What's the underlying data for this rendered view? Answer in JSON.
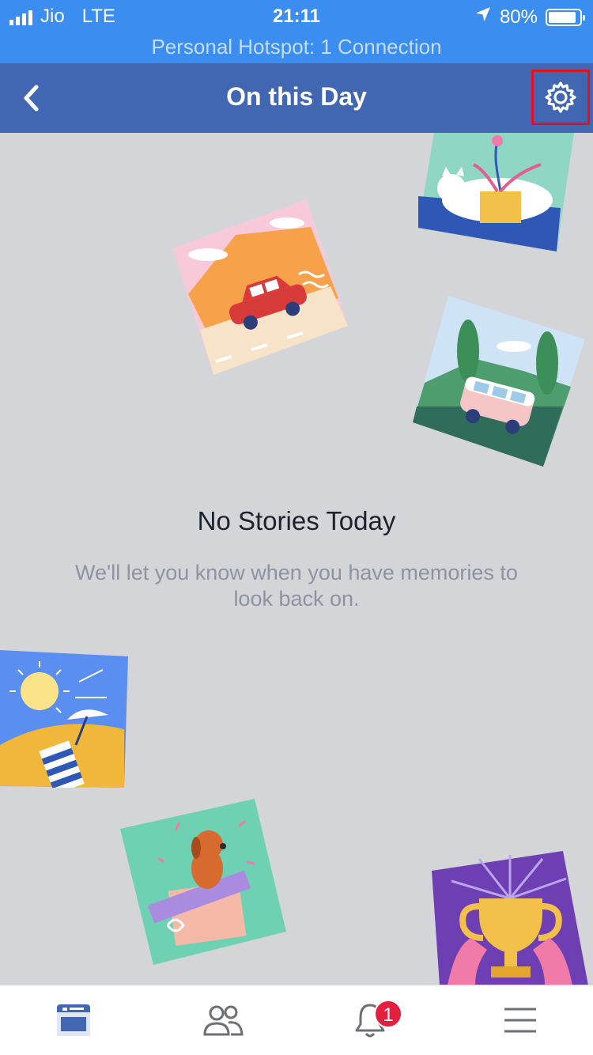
{
  "status_bar": {
    "carrier": "Jio",
    "network": "LTE",
    "time": "21:11",
    "battery": "80%",
    "battery_level": 0.8
  },
  "hotspot": {
    "text": "Personal Hotspot: 1 Connection"
  },
  "nav": {
    "title": "On this Day",
    "back_icon": "chevron-left-icon",
    "settings_icon": "gear-icon"
  },
  "empty_state": {
    "title": "No Stories Today",
    "subtitle": "We'll let you know when you have memories to look back on."
  },
  "illustrations": [
    {
      "name": "cat-plant-illustration"
    },
    {
      "name": "car-road-illustration"
    },
    {
      "name": "van-hills-illustration"
    },
    {
      "name": "beach-sun-illustration"
    },
    {
      "name": "dog-gift-illustration"
    },
    {
      "name": "trophy-illustration"
    }
  ],
  "tab_bar": {
    "tabs": [
      {
        "name": "news-feed-tab",
        "icon": "news-feed-icon",
        "active": true
      },
      {
        "name": "friends-tab",
        "icon": "friends-icon",
        "active": false
      },
      {
        "name": "notifications-tab",
        "icon": "bell-icon",
        "active": false,
        "badge": "1"
      },
      {
        "name": "menu-tab",
        "icon": "hamburger-menu-icon",
        "active": false
      }
    ]
  },
  "colors": {
    "status_bar": "#3b8ef0",
    "nav_bar": "#4267b2",
    "background": "#d4d5d9",
    "active_tab": "#4267b2",
    "inactive_tab": "#6d6f73",
    "badge": "#e41e3f",
    "highlight_box": "#e0102a"
  }
}
